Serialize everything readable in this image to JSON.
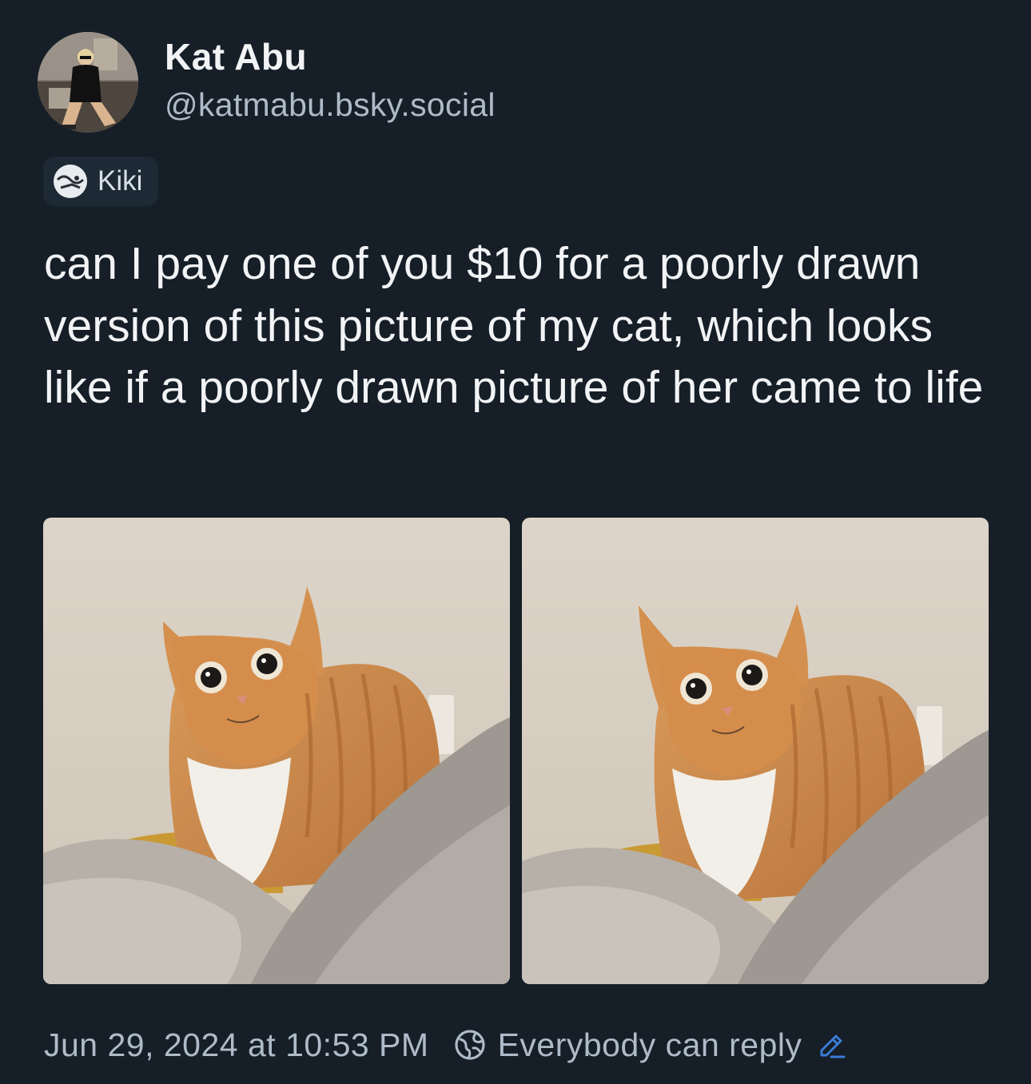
{
  "author": {
    "name": "Kat Abu",
    "handle": "@katmabu.bsky.social"
  },
  "label": {
    "icon": "kiki-avatar-icon",
    "text": "Kiki"
  },
  "post": {
    "text": "can I pay one of you $10 for a poorly drawn version of this picture of my cat, which looks like if a poorly drawn picture of her came to life"
  },
  "images": [
    {
      "subject": "orange tabby cat"
    },
    {
      "subject": "orange tabby cat"
    }
  ],
  "meta": {
    "timestamp": "Jun 29, 2024 at 10:53 PM",
    "reply_setting": "Everybody can reply",
    "reply_icon": "globe-icon",
    "edit_icon": "pencil-icon"
  },
  "colors": {
    "background": "#161e27",
    "text_primary": "#f1f3f5",
    "text_secondary": "#aebbc9",
    "accent": "#3a7bd5"
  }
}
